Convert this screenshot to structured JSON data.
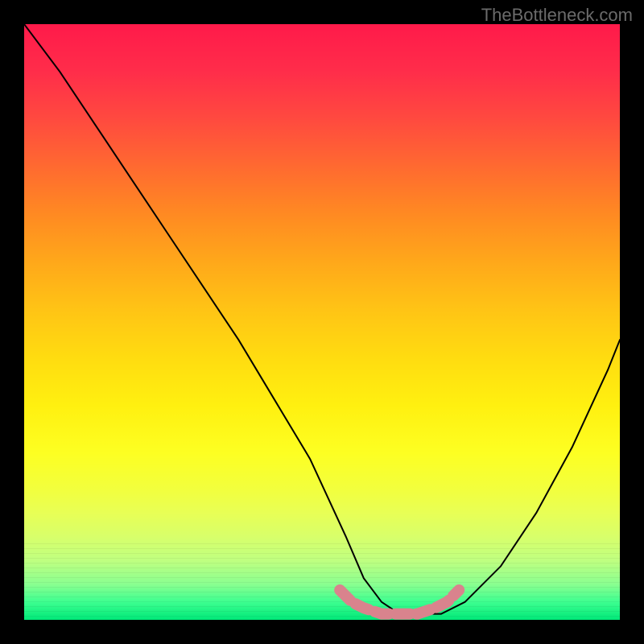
{
  "watermark": "TheBottleneck.com",
  "chart_data": {
    "type": "line",
    "title": "",
    "xlabel": "",
    "ylabel": "",
    "xlim": [
      0,
      100
    ],
    "ylim": [
      0,
      100
    ],
    "grid": false,
    "series": [
      {
        "name": "bottleneck-curve",
        "color": "#000000",
        "x": [
          0,
          6,
          12,
          18,
          24,
          30,
          36,
          42,
          48,
          54,
          57,
          60,
          63,
          66,
          70,
          74,
          80,
          86,
          92,
          98,
          100
        ],
        "y": [
          100,
          92,
          83,
          74,
          65,
          56,
          47,
          37,
          27,
          14,
          7,
          3,
          1,
          1,
          1,
          3,
          9,
          18,
          29,
          42,
          47
        ]
      },
      {
        "name": "minimum-highlight",
        "color": "#d9838d",
        "x": [
          53,
          55,
          57,
          60,
          63,
          66,
          69,
          71,
          73
        ],
        "y": [
          5,
          3,
          2,
          1,
          1,
          1,
          2,
          3,
          5
        ]
      }
    ],
    "background_gradient": {
      "top": "#ff1a4a",
      "mid": "#fff010",
      "bottom": "#00e878"
    }
  }
}
